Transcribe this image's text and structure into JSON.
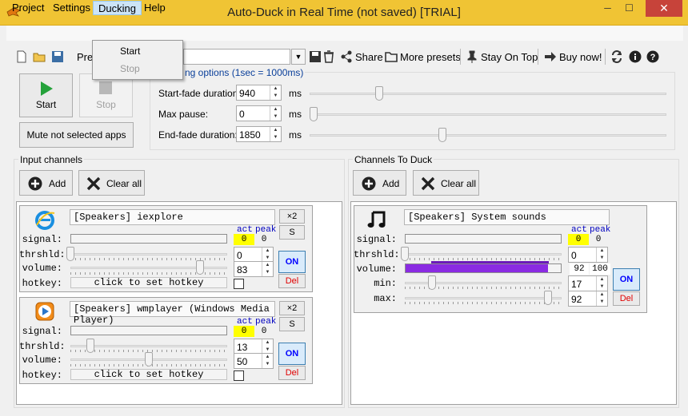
{
  "window": {
    "title": "Auto-Duck in Real Time (not saved) [TRIAL]",
    "minimize": "─",
    "maximize": "☐",
    "close": "✕"
  },
  "menu": {
    "items": [
      "Project",
      "Settings",
      "Ducking",
      "Help"
    ],
    "ducking_dropdown": [
      "Start",
      "Stop"
    ]
  },
  "toolbar": {
    "presets_label": "Pres",
    "share": "Share",
    "more_presets": "More presets",
    "stay_on_top": "Stay On Top",
    "buy_now": "Buy now!"
  },
  "controls": {
    "start": "Start",
    "stop": "Stop",
    "mute_not_selected": "Mute not selected apps"
  },
  "ducking_options": {
    "header": "ng options (1sec = 1000ms)",
    "start_fade_label": "Start-fade duration:",
    "start_fade_value": "940",
    "max_pause_label": "Max pause:",
    "max_pause_value": "0",
    "end_fade_label": "End-fade duration:",
    "end_fade_value": "1850",
    "unit": "ms"
  },
  "input_channels": {
    "title": "Input channels",
    "add": "Add",
    "clear_all": "Clear all",
    "labels": {
      "signal": "signal:",
      "thrshld": "thrshld:",
      "volume": "volume:",
      "hotkey": "hotkey:",
      "act": "act",
      "peak": "peak",
      "hotkey_hint": "click to set hotkey",
      "x2": "×2",
      "s": "S",
      "on": "ON",
      "del": "Del"
    },
    "channels": [
      {
        "name": "[Speakers] iexplore",
        "act": "0",
        "peak": "0",
        "threshold": "0",
        "volume": "83"
      },
      {
        "name": "[Speakers] wmplayer (Windows Media Player)",
        "act": "0",
        "peak": "0",
        "threshold": "13",
        "volume": "50"
      }
    ]
  },
  "duck_channels": {
    "title": "Channels To Duck",
    "add": "Add",
    "clear_all": "Clear all",
    "labels": {
      "signal": "signal:",
      "thrshld": "thrshld:",
      "volume": "volume:",
      "min": "min:",
      "max": "max:",
      "act": "act",
      "peak": "peak",
      "on": "ON",
      "del": "Del"
    },
    "channels": [
      {
        "name": "[Speakers] System sounds",
        "act": "0",
        "peak": "0",
        "threshold": "0",
        "volume_current": "92",
        "volume_max": "100",
        "min": "17",
        "max": "92"
      }
    ]
  },
  "colors": {
    "titlebar": "#f0c434",
    "close_button": "#c7433a",
    "volume_bar": "#8a2be2",
    "level_highlight": "#ffff00"
  }
}
